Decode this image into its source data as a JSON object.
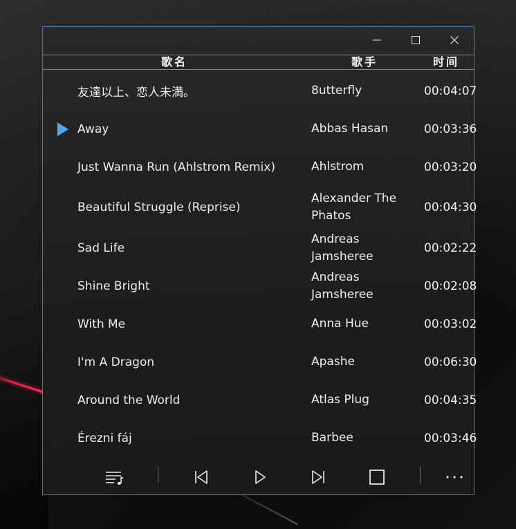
{
  "header": {
    "name": "歌名",
    "artist": "歌手",
    "time": "时间"
  },
  "tracks": [
    {
      "name": "友達以上、恋人未満。",
      "artist": "8utterfly",
      "time": "00:04:07"
    },
    {
      "name": "Away",
      "artist": "Abbas Hasan",
      "time": "00:03:36",
      "playing": true
    },
    {
      "name": "Just Wanna Run (Ahlstrom Remix)",
      "artist": "Ahlstrom",
      "time": "00:03:20"
    },
    {
      "name": "Beautiful Struggle (Reprise)",
      "artist": "Alexander The Phatos",
      "time": "00:04:30"
    },
    {
      "name": "Sad Life",
      "artist": "Andreas Jamsheree",
      "time": "00:02:22"
    },
    {
      "name": "Shine Bright",
      "artist": "Andreas Jamsheree",
      "time": "00:02:08"
    },
    {
      "name": "With Me",
      "artist": "Anna Hue",
      "time": "00:03:02"
    },
    {
      "name": "I'm A Dragon",
      "artist": "Apashe",
      "time": "00:06:30"
    },
    {
      "name": "Around the World",
      "artist": "Atlas Plug",
      "time": "00:04:35"
    },
    {
      "name": "Érezni fáj",
      "artist": "Barbee",
      "time": "00:03:46"
    }
  ],
  "icons": {
    "minimize": "minimize-icon",
    "maximize": "maximize-icon",
    "close": "close-icon",
    "playlist": "playlist-icon",
    "previous": "previous-track-icon",
    "play": "play-icon",
    "next": "next-track-icon",
    "stop": "stop-icon",
    "more": "more-icon",
    "now_playing": "now-playing-icon"
  },
  "colors": {
    "window_border": "#2f7fc9",
    "accent": "#5aa7e6",
    "text": "#eeeeee"
  }
}
